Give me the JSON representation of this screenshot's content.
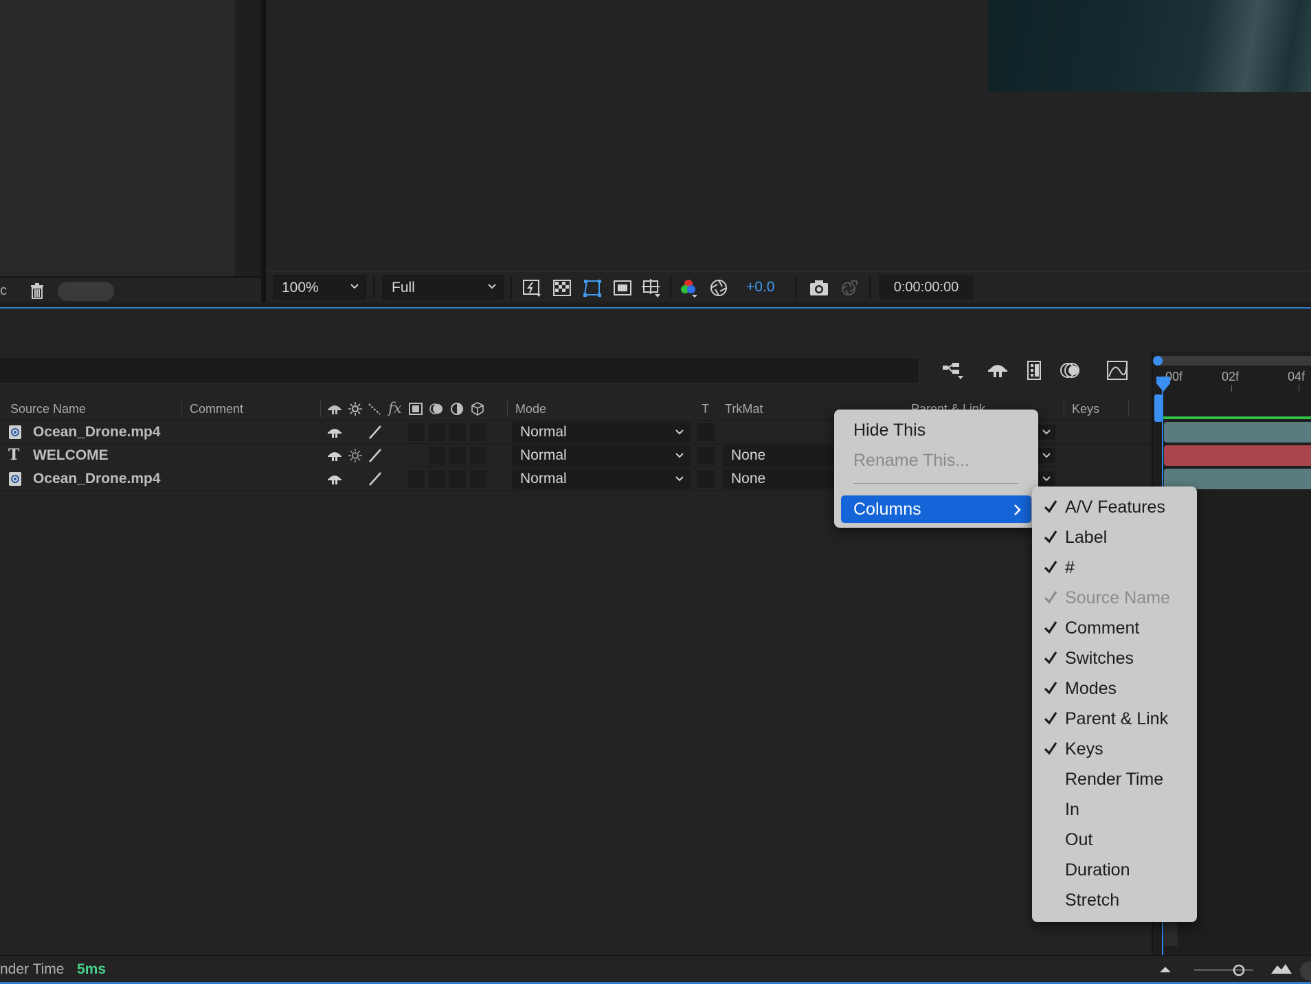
{
  "project_panel": {
    "footer_fragment": "c"
  },
  "viewer": {
    "zoom": "100%",
    "resolution": "Full",
    "exposure": "+0.0",
    "timecode": "0:00:00:00"
  },
  "timeline": {
    "columns": {
      "source_name": "Source Name",
      "comment": "Comment",
      "mode": "Mode",
      "t": "T",
      "trkmat": "TrkMat",
      "parent_link": "Parent & Link",
      "keys": "Keys"
    },
    "layers": [
      {
        "name": "Ocean_Drone.mp4",
        "type": "footage",
        "mode": "Normal",
        "trkmat": ""
      },
      {
        "name": "WELCOME",
        "type": "text",
        "mode": "Normal",
        "trkmat": "None"
      },
      {
        "name": "Ocean_Drone.mp4",
        "type": "footage",
        "mode": "Normal",
        "trkmat": "None"
      }
    ],
    "ruler": {
      "labels": [
        "00f",
        "02f",
        "04f"
      ]
    },
    "layer_bar_colors": [
      "#5b7c7f",
      "#a8464b",
      "#5b7c7f"
    ]
  },
  "status": {
    "label": "nder Time",
    "value": "5ms"
  },
  "context_menu": {
    "hide_this": "Hide This",
    "rename_this": "Rename This...",
    "columns": "Columns"
  },
  "columns_submenu": {
    "items": [
      {
        "label": "A/V Features",
        "checked": true,
        "enabled": true
      },
      {
        "label": "Label",
        "checked": true,
        "enabled": true
      },
      {
        "label": "#",
        "checked": true,
        "enabled": true
      },
      {
        "label": "Source Name",
        "checked": true,
        "enabled": false
      },
      {
        "label": "Comment",
        "checked": true,
        "enabled": true
      },
      {
        "label": "Switches",
        "checked": true,
        "enabled": true
      },
      {
        "label": "Modes",
        "checked": true,
        "enabled": true
      },
      {
        "label": "Parent & Link",
        "checked": true,
        "enabled": true
      },
      {
        "label": "Keys",
        "checked": true,
        "enabled": true
      },
      {
        "label": "Render Time",
        "checked": false,
        "enabled": true
      },
      {
        "label": "In",
        "checked": false,
        "enabled": true
      },
      {
        "label": "Out",
        "checked": false,
        "enabled": true
      },
      {
        "label": "Duration",
        "checked": false,
        "enabled": true
      },
      {
        "label": "Stretch",
        "checked": false,
        "enabled": true
      }
    ]
  }
}
